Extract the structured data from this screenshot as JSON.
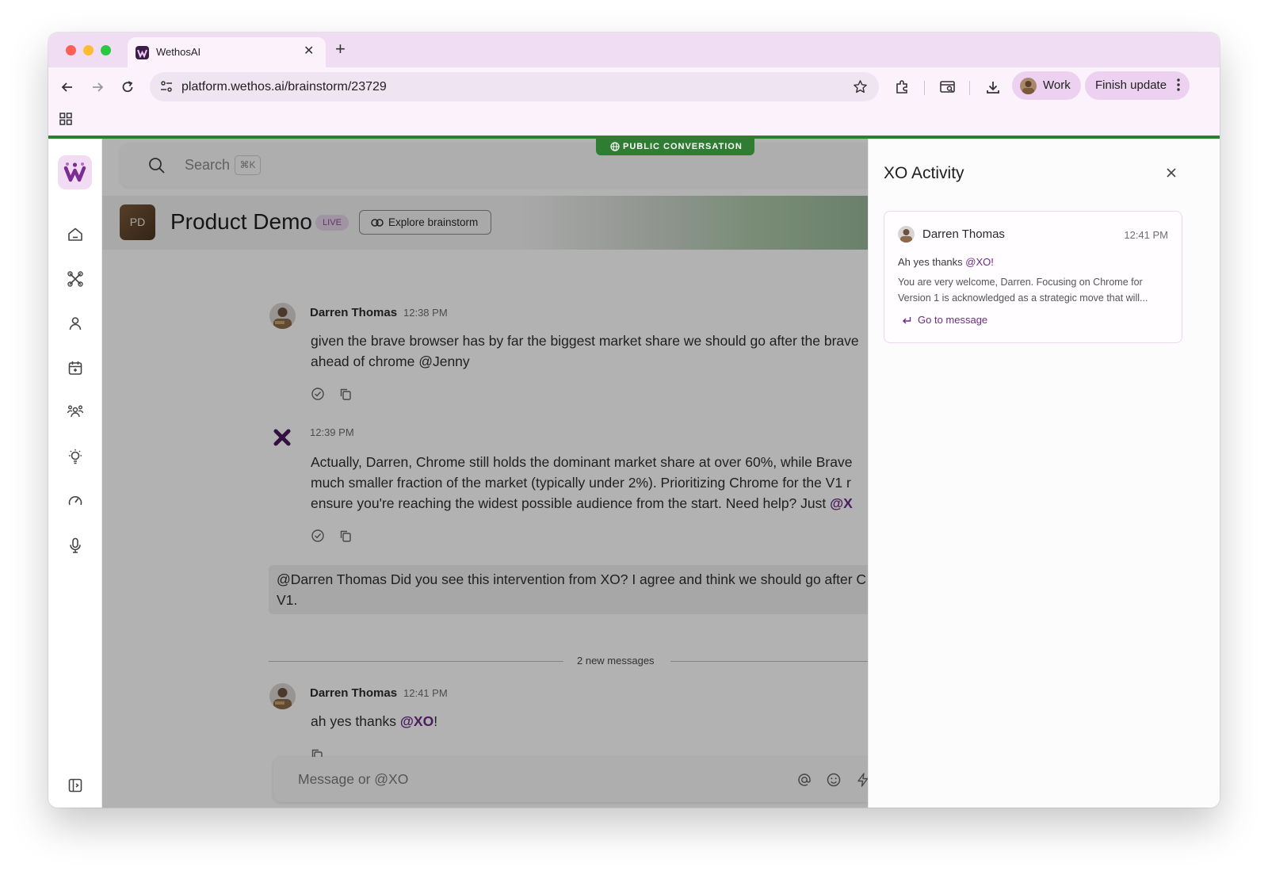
{
  "browser": {
    "tab_title": "WethosAI",
    "url": "platform.wethos.ai/brainstorm/23729",
    "profile_label": "Work",
    "update_label": "Finish update"
  },
  "app": {
    "banner": "PUBLIC CONVERSATION",
    "search": {
      "placeholder": "Search",
      "shortcut": "⌘K"
    },
    "header": {
      "avatar_initials": "PD",
      "title": "Product Demo",
      "live_badge": "LIVE",
      "explore_label": "Explore brainstorm"
    },
    "messages": [
      {
        "author": "Darren Thomas",
        "time": "12:38 PM",
        "lines": [
          "given the brave browser has by far the biggest market share we should go after the brave",
          "ahead of chrome @Jenny"
        ]
      },
      {
        "author": "",
        "time": "12:39 PM",
        "lines": [
          "Actually, Darren, Chrome still holds the dominant market share at over 60%, while Brave",
          "much smaller fraction of the market (typically under 2%). Prioritizing Chrome for the V1 r",
          "ensure you're reaching the widest possible audience from the start. Need help? Just "
        ],
        "mention": "@X"
      }
    ],
    "quote": {
      "line1": "@Darren Thomas Did you see this intervention from XO? I agree and think we should go after C",
      "line2": "V1."
    },
    "new_messages_divider": "2 new messages",
    "latest_message": {
      "author": "Darren Thomas",
      "time": "12:41 PM",
      "text": "ah yes thanks ",
      "mention": "@XO",
      "suffix": "!"
    },
    "composer_placeholder": "Message or @XO"
  },
  "panel": {
    "title": "XO Activity",
    "card": {
      "author": "Darren Thomas",
      "time": "12:41 PM",
      "quote_text": "Ah yes thanks ",
      "quote_mention": "@XO!",
      "reply": "You are very welcome, Darren. Focusing on Chrome for Version 1 is acknowledged as a strategic move that will...",
      "link": "Go to message"
    }
  },
  "colors": {
    "accent_purple": "#6b2a86",
    "banner_green": "#2e7d32",
    "chrome_tint": "#f0dcf3"
  },
  "icons": [
    "home-icon",
    "brainstorm-icon",
    "person-icon",
    "calendar-icon",
    "team-icon",
    "lightbulb-icon",
    "gauge-icon",
    "microphone-icon",
    "sidebar-toggle-icon",
    "search-icon",
    "close-icon",
    "link-icon",
    "globe-icon",
    "check-circle-icon",
    "copy-icon",
    "at-icon",
    "emoji-icon",
    "bolt-icon"
  ]
}
